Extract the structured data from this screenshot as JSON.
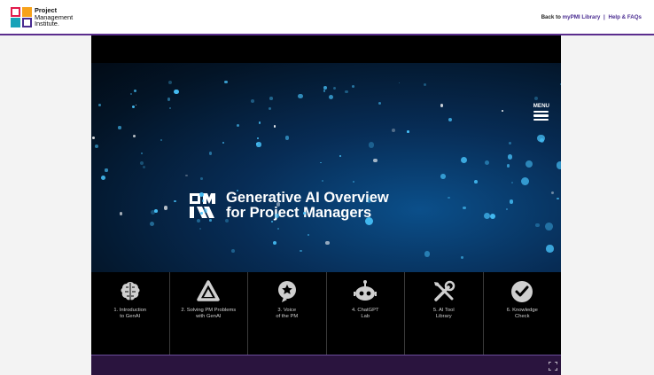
{
  "header": {
    "logo_line1": "Project",
    "logo_line2": "Management",
    "logo_line3": "Institute.",
    "back_prefix": "Back to",
    "library_link": "myPMI Library",
    "separator": "|",
    "help_link": "Help & FAQs"
  },
  "player": {
    "menu_label": "MENU",
    "title_line1": "Generative AI Overview",
    "title_line2": "for Project Managers",
    "nav": [
      {
        "label": "1. Introduction\nto GenAI",
        "icon": "brain-icon"
      },
      {
        "label": "2. Solving PM Problems\nwith GenAI",
        "icon": "triangle-logo-icon"
      },
      {
        "label": "3. Voice\nof the PM",
        "icon": "star-badge-icon"
      },
      {
        "label": "4. ChatGPT\nLab",
        "icon": "robot-icon"
      },
      {
        "label": "5. AI Tool\nLibrary",
        "icon": "tools-icon"
      },
      {
        "label": "6. Knowledge\nCheck",
        "icon": "checkmark-icon"
      }
    ]
  },
  "colors": {
    "accent_purple": "#5b2d8e",
    "link_purple": "#4a2c91",
    "bottom_bar": "#2a143e",
    "particle_blue": "#49c7ff"
  }
}
